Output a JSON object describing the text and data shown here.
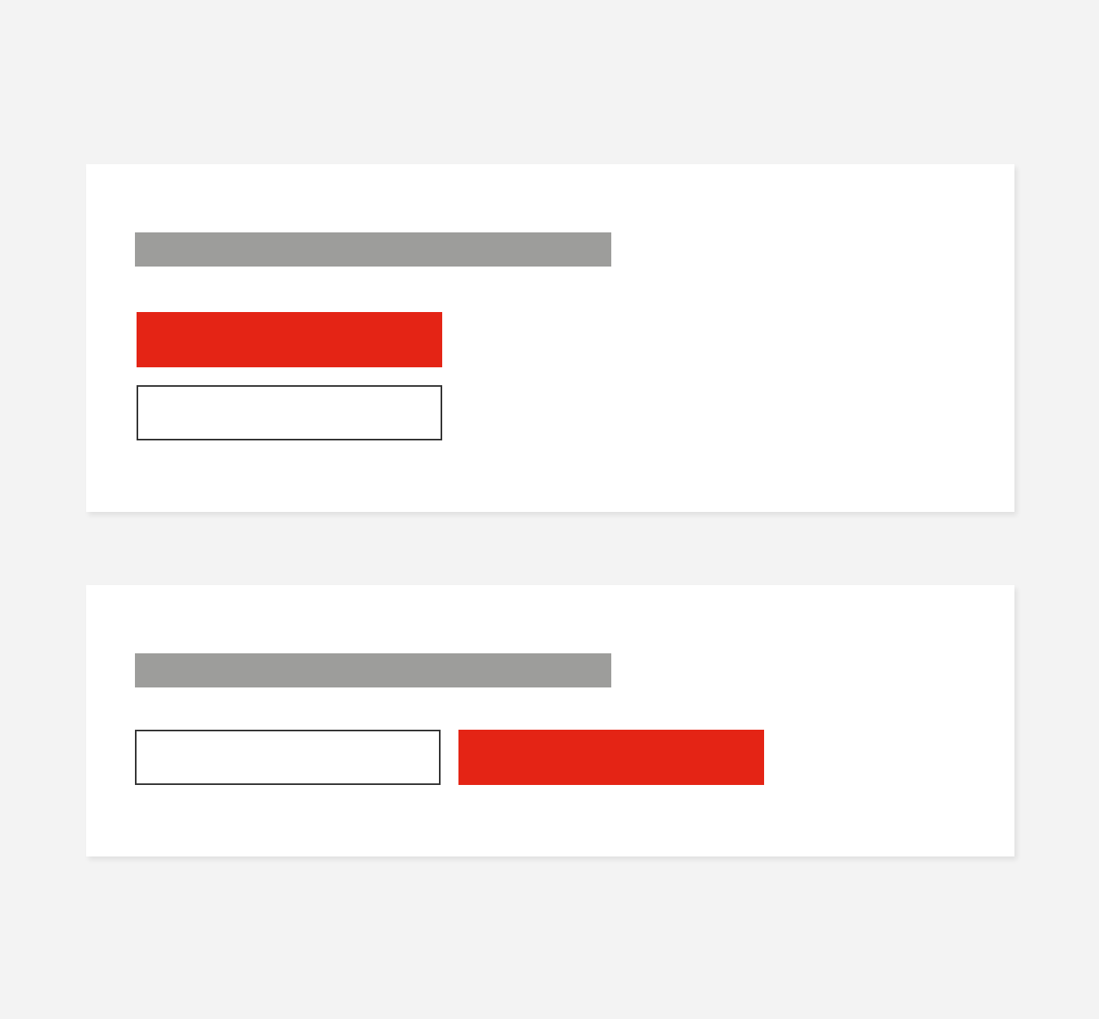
{
  "cards": [
    {
      "kind": "stacked",
      "buttons": [
        {
          "kind": "primary"
        },
        {
          "kind": "secondary"
        }
      ]
    },
    {
      "kind": "row",
      "buttons": [
        {
          "kind": "secondary"
        },
        {
          "kind": "primary"
        }
      ]
    }
  ]
}
